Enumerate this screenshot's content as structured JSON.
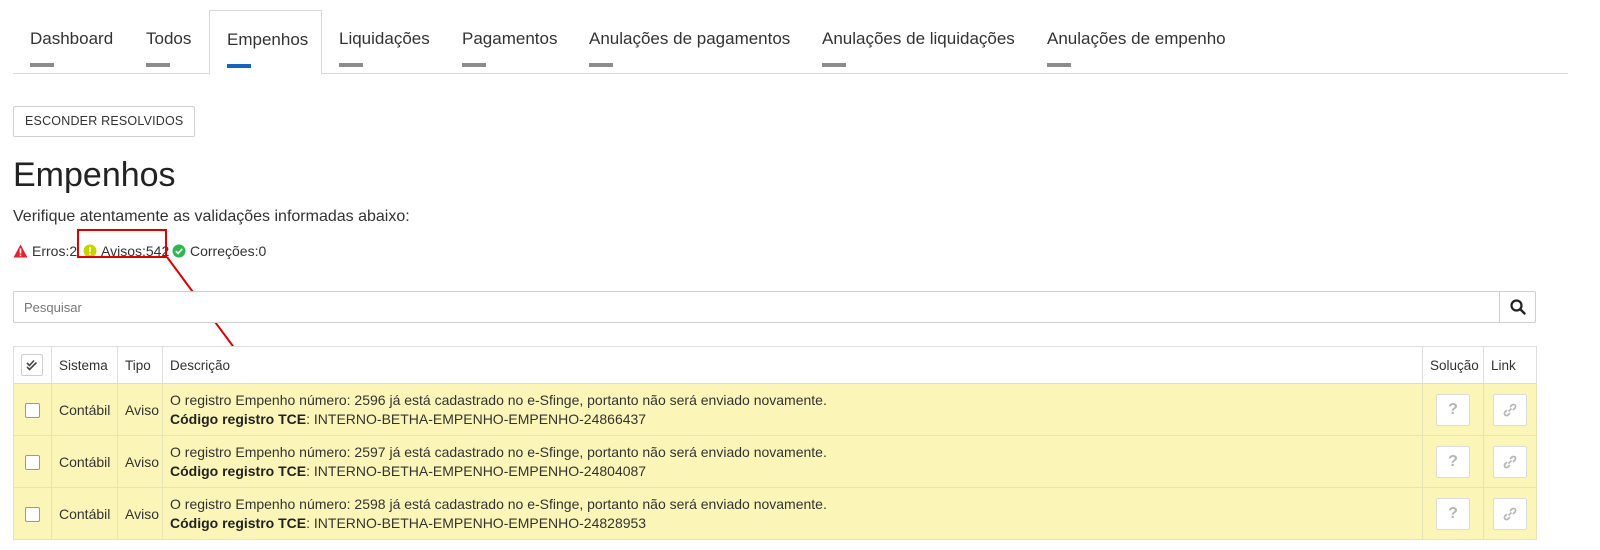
{
  "tabs": [
    {
      "label": "Dashboard",
      "active": false
    },
    {
      "label": "Todos",
      "active": false
    },
    {
      "label": "Empenhos",
      "active": true
    },
    {
      "label": "Liquidações",
      "active": false
    },
    {
      "label": "Pagamentos",
      "active": false
    },
    {
      "label": "Anulações de pagamentos",
      "active": false
    },
    {
      "label": "Anulações de liquidações",
      "active": false
    },
    {
      "label": "Anulações de empenho",
      "active": false
    }
  ],
  "toolbar": {
    "hide_resolved_label": "ESCONDER RESOLVIDOS"
  },
  "page": {
    "title": "Empenhos",
    "subtitle": "Verifique atentamente as validações informadas abaixo:"
  },
  "stats": {
    "errors": "Erros:2",
    "warnings": "Avisos:542",
    "corrections": "Correções:0"
  },
  "colors": {
    "error": "#e8202a",
    "warning": "#c8d400",
    "correction": "#2db84d",
    "active_tab": "#1565c0",
    "row_warning": "#fbf6b8",
    "annotation": "#e00000"
  },
  "search": {
    "placeholder": "Pesquisar",
    "value": "",
    "icon": "search-icon"
  },
  "table": {
    "headers": {
      "select": "double-check-icon",
      "sistema": "Sistema",
      "tipo": "Tipo",
      "descricao": "Descrição",
      "solucao": "Solução",
      "link": "Link"
    },
    "code_label": "Código registro TCE",
    "rows": [
      {
        "sistema": "Contábil",
        "tipo": "Aviso",
        "message": "O registro Empenho número: 2596 já está cadastrado no e-Sfinge, portanto não será enviado novamente.",
        "code": ": INTERNO-BETHA-EMPENHO-EMPENHO-24866437",
        "solution_icon": "?"
      },
      {
        "sistema": "Contábil",
        "tipo": "Aviso",
        "message": "O registro Empenho número: 2597 já está cadastrado no e-Sfinge, portanto não será enviado novamente.",
        "code": ": INTERNO-BETHA-EMPENHO-EMPENHO-24804087",
        "solution_icon": "?"
      },
      {
        "sistema": "Contábil",
        "tipo": "Aviso",
        "message": "O registro Empenho número: 2598 já está cadastrado no e-Sfinge, portanto não será enviado novamente.",
        "code": ": INTERNO-BETHA-EMPENHO-EMPENHO-24828953",
        "solution_icon": "?"
      }
    ]
  }
}
